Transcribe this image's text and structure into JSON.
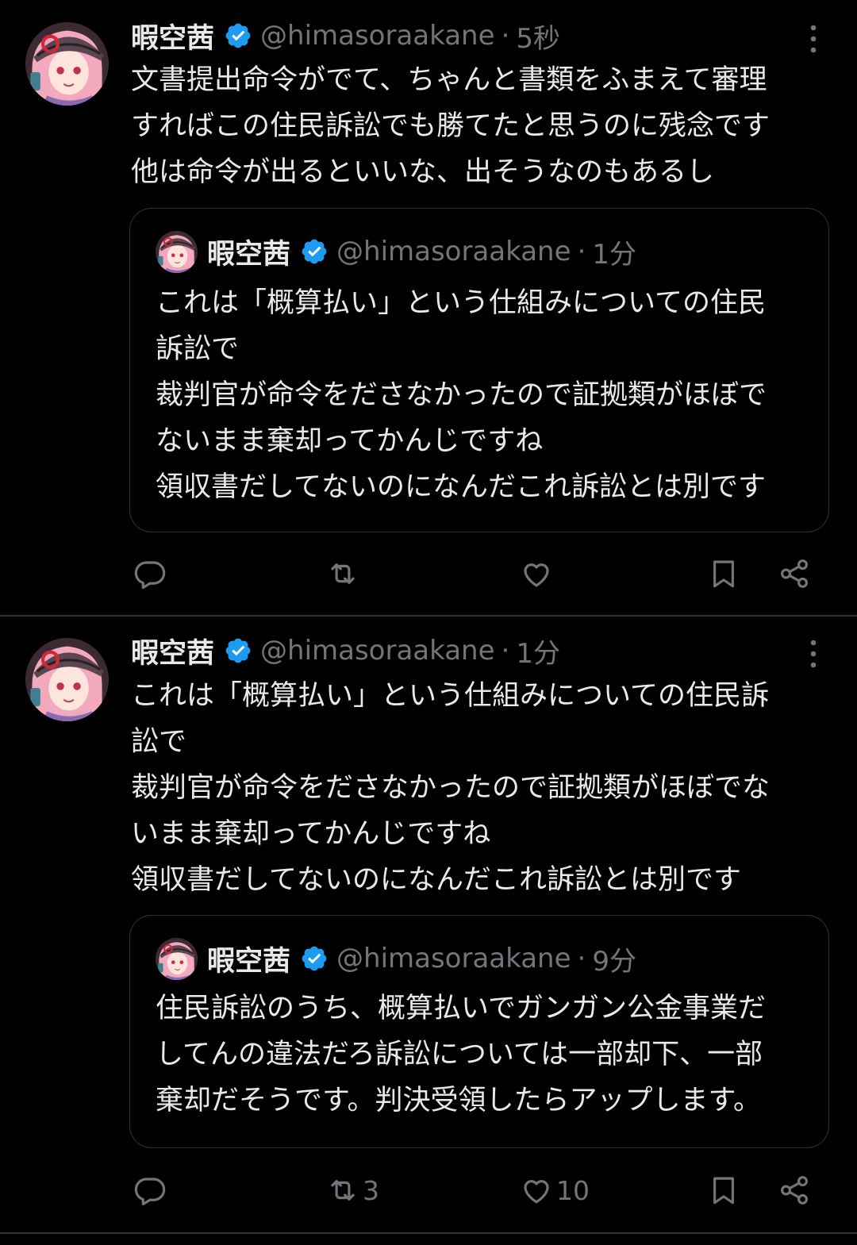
{
  "tweets": [
    {
      "author": {
        "name": "暇空茜",
        "handle": "@himasoraakane",
        "separator": "·",
        "time": "5秒"
      },
      "text": "文書提出命令がでて、ちゃんと書類をふまえて審理\nすればこの住民訴訟でも勝てたと思うのに残念です\n他は命令が出るといいな、出そうなのもあるし",
      "quote": {
        "author": {
          "name": "暇空茜",
          "handle": "@himasoraakane",
          "separator": "·",
          "time": "1分"
        },
        "text": "これは「概算払い」という仕組みについての住民\n訴訟で\n裁判官が命令をださなかったので証拠類がほぼで\nないまま棄却ってかんじですね\n領収書だしてないのになんだこれ訴訟とは別です"
      },
      "stats": {
        "replies": "",
        "retweets": "",
        "likes": ""
      }
    },
    {
      "author": {
        "name": "暇空茜",
        "handle": "@himasoraakane",
        "separator": "·",
        "time": "1分"
      },
      "text": "これは「概算払い」という仕組みについての住民訴\n訟で\n裁判官が命令をださなかったので証拠類がほぼでな\nいまま棄却ってかんじですね\n領収書だしてないのになんだこれ訴訟とは別です",
      "quote": {
        "author": {
          "name": "暇空茜",
          "handle": "@himasoraakane",
          "separator": "·",
          "time": "9分"
        },
        "text": "住民訴訟のうち、概算払いでガンガン公金事業だ\nしてんの違法だろ訴訟については一部却下、一部\n棄却だそうです。判決受領したらアップします。"
      },
      "stats": {
        "replies": "",
        "retweets": "3",
        "likes": "10"
      }
    }
  ],
  "icons": {
    "verified": "verified-badge-icon",
    "more": "more-vertical-icon",
    "reply": "reply-icon",
    "retweet": "retweet-icon",
    "like": "heart-icon",
    "bookmark": "bookmark-icon",
    "share": "share-icon"
  },
  "colors": {
    "background": "#000000",
    "text": "#e7e9ea",
    "secondary": "#71767b",
    "verified": "#1d9bf0",
    "border": "#2f3336"
  }
}
